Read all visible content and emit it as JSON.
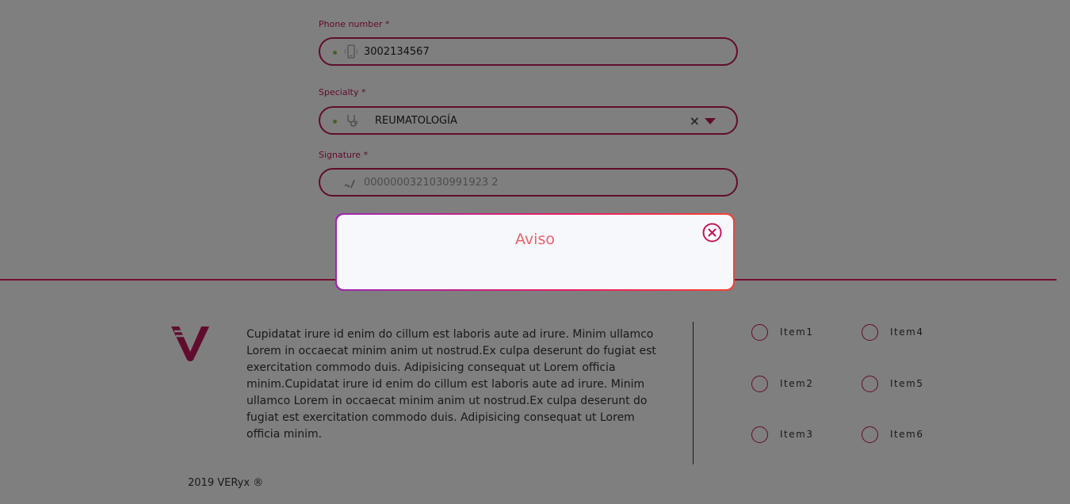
{
  "form": {
    "phone": {
      "label": "Phone number *",
      "value": "3002134567"
    },
    "specialty": {
      "label": "Specialty *",
      "value": "REUMATOLOGÍA"
    },
    "signature": {
      "label": "Signature *",
      "placeholder": "0000000321030991923 2"
    }
  },
  "modal": {
    "title": "Aviso"
  },
  "footer": {
    "description": "Cupidatat irure id enim do cillum est laboris aute ad irure. Minim ullamco Lorem in occaecat minim anim ut nostrud.Ex culpa deserunt do fugiat est exercitation commodo duis. Adipisicing consequat ut Lorem officia minim.Cupidatat irure id enim do cillum est laboris aute ad irure. Minim ullamco Lorem in occaecat minim anim ut nostrud.Ex culpa deserunt do fugiat est exercitation commodo duis. Adipisicing consequat ut Lorem officia minim.",
    "items": [
      "Item1",
      "Item2",
      "Item3",
      "Item4",
      "Item5",
      "Item6"
    ],
    "copyright": "2019 VERyx ®"
  },
  "icons": {
    "phone": "mobile-phone-icon",
    "specialty": "stethoscope-icon",
    "signature": "signature-icon",
    "clear": "clear-icon",
    "dropdown": "caret-down-icon",
    "close": "close-circle-icon",
    "logo": "veryx-logo"
  },
  "colors": {
    "accent": "#c2185b",
    "title": "#ef5f6b",
    "valid_dot": "#8bc34a",
    "overlay": "rgba(0,0,0,0.5)"
  }
}
